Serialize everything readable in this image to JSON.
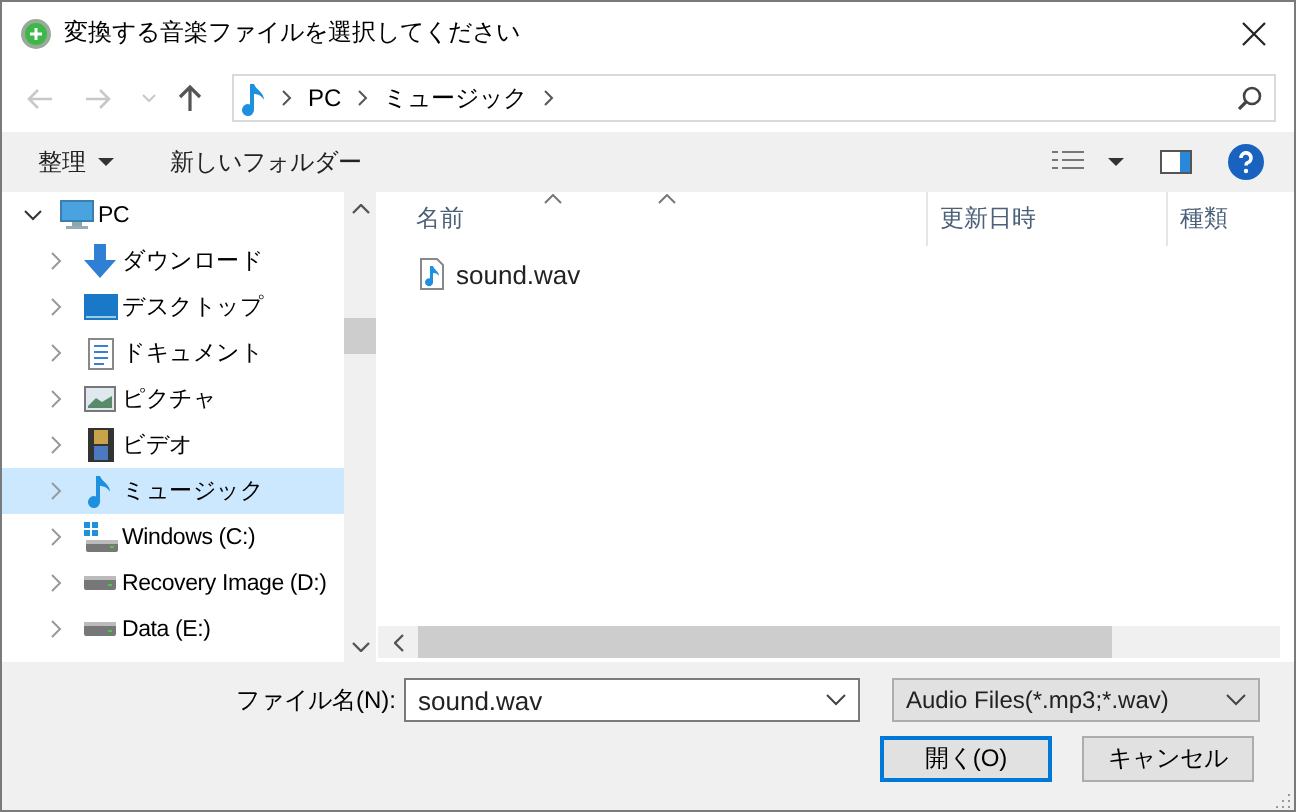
{
  "window": {
    "title": "変換する音楽ファイルを選択してください"
  },
  "nav_buttons": [
    {
      "kind": "back",
      "disabled": true
    },
    {
      "kind": "forward",
      "disabled": true
    },
    {
      "kind": "recent",
      "disabled": true
    },
    {
      "kind": "up",
      "disabled": false
    }
  ],
  "address": {
    "segments": [
      "PC",
      "ミュージック"
    ]
  },
  "toolbar": {
    "organize": "整理",
    "new_folder": "新しいフォルダー"
  },
  "tree": [
    {
      "label": "PC",
      "kind": "pc",
      "expanded": true,
      "selected": false,
      "children": [
        {
          "label": "ダウンロード",
          "kind": "download",
          "expanded": false,
          "selected": false
        },
        {
          "label": "デスクトップ",
          "kind": "desktop",
          "expanded": false,
          "selected": false
        },
        {
          "label": "ドキュメント",
          "kind": "documents",
          "expanded": false,
          "selected": false
        },
        {
          "label": "ピクチャ",
          "kind": "pictures",
          "expanded": false,
          "selected": false
        },
        {
          "label": "ビデオ",
          "kind": "videos",
          "expanded": false,
          "selected": false
        },
        {
          "label": "ミュージック",
          "kind": "music",
          "expanded": false,
          "selected": true
        },
        {
          "label": "Windows (C:)",
          "kind": "system_drive",
          "expanded": false,
          "selected": false
        },
        {
          "label": "Recovery Image (D:)",
          "kind": "drive",
          "expanded": false,
          "selected": false
        },
        {
          "label": "Data (E:)",
          "kind": "drive",
          "expanded": false,
          "selected": false
        }
      ]
    }
  ],
  "file_list": {
    "columns": [
      "名前",
      "更新日時",
      "種類"
    ],
    "files": [
      "sound.wav"
    ]
  },
  "bottom": {
    "filename_label": "ファイル名(N):",
    "filename_value": "sound.wav",
    "filter": "Audio Files(*.mp3;*.wav)",
    "buttons": [
      {
        "label": "開く(O)",
        "default": true
      },
      {
        "label": "キャンセル",
        "default": false
      }
    ]
  }
}
